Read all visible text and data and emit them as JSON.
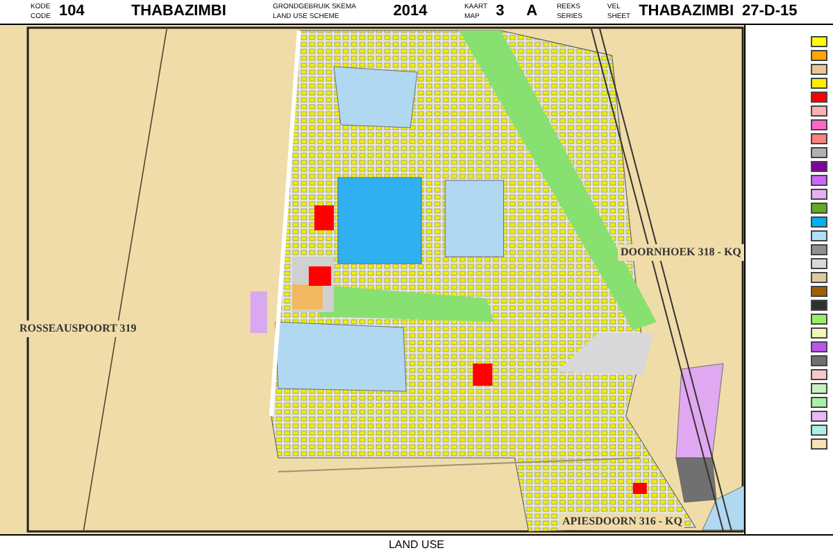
{
  "header": {
    "code_label": [
      "KODE",
      "CODE"
    ],
    "code": "104",
    "town": "THABAZIMBI",
    "scheme_label": [
      "GRONDGEBRUIK SKEMA",
      "LAND USE SCHEME"
    ],
    "year": "2014",
    "map_label": [
      "KAART",
      "MAP"
    ],
    "map_number": "3",
    "map_letter": "A",
    "series_label": [
      "REEKS",
      "SERIES"
    ],
    "sheet_label": [
      "VEL",
      "SHEET"
    ],
    "sheet_town": "THABAZIMBI",
    "sheet_number": "27-D-15"
  },
  "map": {
    "farm_labels": [
      {
        "text": "ROSSEAUSPOORT 319",
        "kind": "west"
      },
      {
        "text": "DOORNHOEK 318 - KQ",
        "kind": "east"
      },
      {
        "text": "APIESDOORN 316 - KQ",
        "kind": "south"
      }
    ]
  },
  "legend": {
    "swatches": [
      {
        "color": "#ffff00"
      },
      {
        "color": "#ffa500"
      },
      {
        "color": "#e8c890"
      },
      {
        "color": "#ffee00"
      },
      {
        "color": "#ff0000"
      },
      {
        "color": "#ffb0b0"
      },
      {
        "color": "#ff66cc"
      },
      {
        "color": "#ff8080"
      },
      {
        "color": "#b0b0b0"
      },
      {
        "color": "#8000a0"
      },
      {
        "color": "#cc66ff"
      },
      {
        "color": "#e6b0f0"
      },
      {
        "color": "#66aa22"
      },
      {
        "color": "#00b0f0"
      },
      {
        "color": "#b0e0f8"
      },
      {
        "color": "#909090"
      },
      {
        "color": "#d8d8d8"
      },
      {
        "color": "#e0c8a0"
      },
      {
        "color": "#a06000"
      },
      {
        "color": "#303030"
      },
      {
        "color": "#99ee66"
      },
      {
        "color": "#eef8b8"
      },
      {
        "color": "#bb55ee"
      },
      {
        "color": "#707070"
      },
      {
        "color": "#f8c8c8"
      },
      {
        "color": "#c8f0c0"
      },
      {
        "color": "#a8f0a8"
      },
      {
        "color": "#e8b8f8"
      },
      {
        "color": "#a8f0e8"
      },
      {
        "color": "#f8e0b0"
      }
    ]
  },
  "footer": {
    "title": "LAND USE"
  }
}
